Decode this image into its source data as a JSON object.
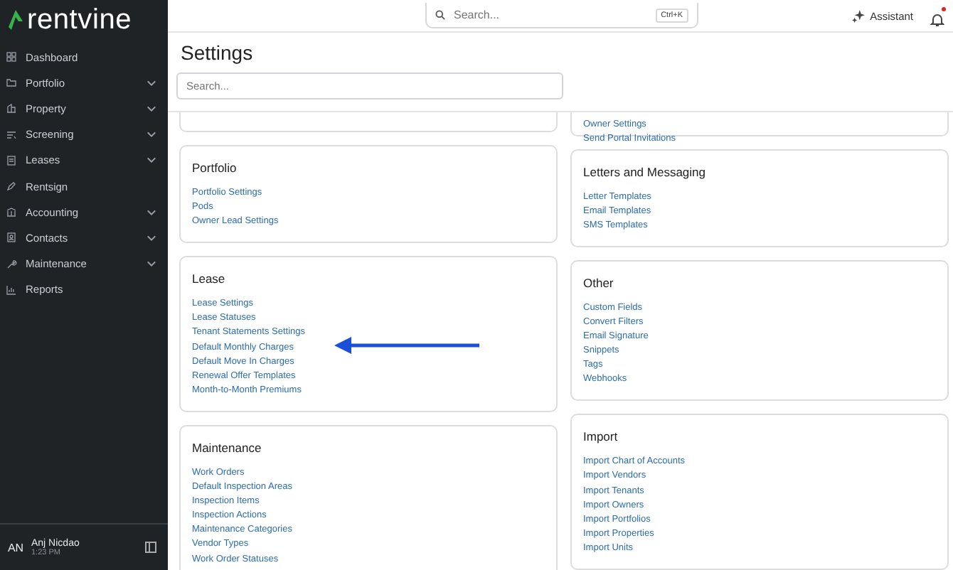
{
  "sidebar": {
    "logo": "rentvine",
    "items": [
      {
        "label": "Dashboard",
        "expandable": false
      },
      {
        "label": "Portfolio",
        "expandable": true
      },
      {
        "label": "Property",
        "expandable": true
      },
      {
        "label": "Screening",
        "expandable": true
      },
      {
        "label": "Leases",
        "expandable": true
      },
      {
        "label": "Rentsign",
        "expandable": false
      },
      {
        "label": "Accounting",
        "expandable": true
      },
      {
        "label": "Contacts",
        "expandable": true
      },
      {
        "label": "Maintenance",
        "expandable": true
      },
      {
        "label": "Reports",
        "expandable": false
      }
    ],
    "user": {
      "initials": "AN",
      "name": "Anj Nicdao",
      "time": "1:23 PM"
    }
  },
  "topbar": {
    "search": {
      "placeholder": "Search...",
      "shortcut": "Ctrl+K"
    },
    "assistant": "Assistant",
    "notifications": true
  },
  "page": {
    "title": "Settings",
    "search": {
      "placeholder": "Search..."
    }
  },
  "columns": [
    [
      {},
      {
        "title": "Portfolio",
        "links": [
          {
            "label": "Portfolio Settings"
          },
          {
            "label": "Pods"
          },
          {
            "label": "Owner Lead Settings"
          }
        ]
      },
      {
        "title": "Lease",
        "links": [
          {
            "label": "Lease Settings",
            "arrow": false
          },
          {
            "label": "Lease Statuses",
            "arrow": false
          },
          {
            "label": "Tenant Statements Settings",
            "arrow": false
          },
          {
            "label": "Default Monthly Charges",
            "arrow": true
          },
          {
            "label": "Default Move In Charges",
            "arrow": false
          },
          {
            "label": "Renewal Offer Templates",
            "arrow": false
          },
          {
            "label": "Month-to-Month Premiums",
            "arrow": false
          }
        ]
      },
      {
        "title": "Maintenance",
        "links": [
          {
            "label": "Work Orders"
          },
          {
            "label": "Default Inspection Areas"
          },
          {
            "label": "Inspection Items"
          },
          {
            "label": "Inspection Actions"
          },
          {
            "label": "Maintenance Categories"
          },
          {
            "label": "Vendor Types"
          },
          {
            "label": "Work Order Statuses"
          }
        ]
      }
    ],
    [
      {
        "links": [
          {
            "label": "Owner Settings"
          },
          {
            "label": "Send Portal Invitations"
          }
        ]
      },
      {
        "title": "Letters and Messaging",
        "links": [
          {
            "label": "Letter Templates"
          },
          {
            "label": "Email Templates"
          },
          {
            "label": "SMS Templates"
          }
        ]
      },
      {
        "title": "Other",
        "links": [
          {
            "label": "Custom Fields"
          },
          {
            "label": "Convert Filters"
          },
          {
            "label": "Email Signature"
          },
          {
            "label": "Snippets"
          },
          {
            "label": "Tags"
          },
          {
            "label": "Webhooks"
          }
        ]
      },
      {
        "title": "Import",
        "links": [
          {
            "label": "Import Chart of Accounts"
          },
          {
            "label": "Import Vendors"
          },
          {
            "label": "Import Tenants"
          },
          {
            "label": "Import Owners"
          },
          {
            "label": "Import Portfolios"
          },
          {
            "label": "Import Properties"
          },
          {
            "label": "Import Units"
          }
        ]
      }
    ]
  ]
}
